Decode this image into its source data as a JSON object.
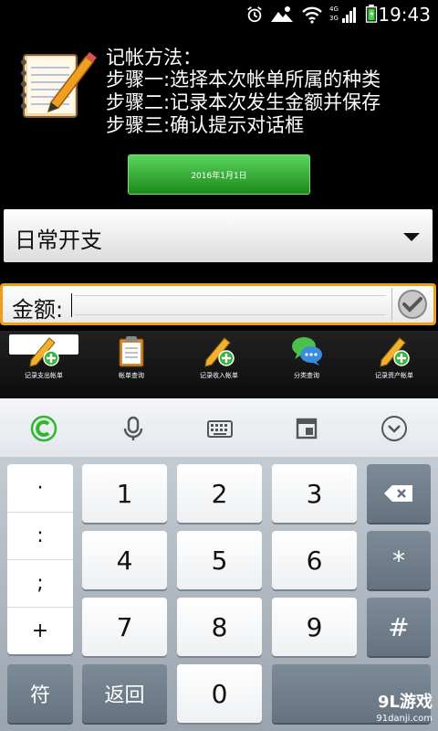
{
  "status_bar": {
    "time": "19:43",
    "network_labels": [
      "4G",
      "3G"
    ],
    "icons": [
      "alarm-icon",
      "weather-icon",
      "wifi-icon",
      "signal-icon",
      "battery-icon"
    ]
  },
  "instructions": {
    "title": "记帐方法：",
    "steps": [
      "步骤一:选择本次帐单所属的种类",
      "步骤二:记录本次发生金额并保存",
      "步骤三:确认提示对话框"
    ]
  },
  "date_button": {
    "label": "2016年1月1日"
  },
  "category_select": {
    "selected": "日常开支"
  },
  "amount_field": {
    "label": "金额:",
    "value": ""
  },
  "toolbar": {
    "items": [
      {
        "label": "记录支出帐单",
        "icon": "pencil-add-icon"
      },
      {
        "label": "帐单查询",
        "icon": "clipboard-icon"
      },
      {
        "label": "记录收入帐单",
        "icon": "pencil-add-icon"
      },
      {
        "label": "分类查询",
        "icon": "chat-bubbles-icon"
      },
      {
        "label": "记录资产帐单",
        "icon": "pencil-add-icon"
      }
    ]
  },
  "keyboard": {
    "top_row_icons": [
      "keyboard-logo-icon",
      "microphone-icon",
      "keyboard-layout-icon",
      "window-icon",
      "collapse-icon"
    ],
    "side_keys": [
      "·",
      ":",
      ";",
      "+"
    ],
    "digits": [
      "1",
      "2",
      "3",
      "4",
      "5",
      "6",
      "7",
      "8",
      "9",
      "0"
    ],
    "delete_icon": "backspace-icon",
    "star": "*",
    "hash": "#",
    "symbol_key": "符",
    "back_key": "返回"
  },
  "watermark": {
    "brand": "9L游戏",
    "url": "91danji.com"
  }
}
